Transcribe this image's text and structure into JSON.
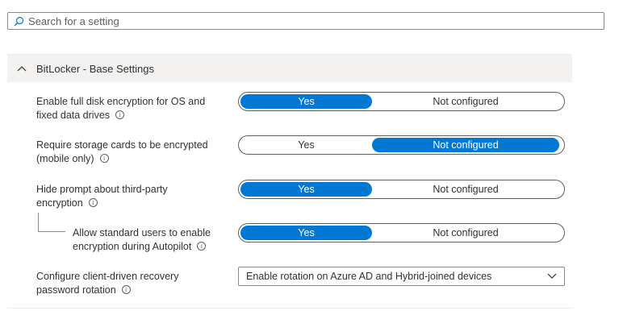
{
  "search": {
    "placeholder": "Search for a setting"
  },
  "section": {
    "title": "BitLocker - Base Settings",
    "expanded": true
  },
  "settings": [
    {
      "label_line1": "Enable full disk encryption for OS and",
      "label_line2": "fixed data drives",
      "options": [
        "Yes",
        "Not configured"
      ],
      "selected": "Yes"
    },
    {
      "label_line1": "Require storage cards to be encrypted",
      "label_line2": "(mobile only)",
      "options": [
        "Yes",
        "Not configured"
      ],
      "selected": "Not configured"
    },
    {
      "label_line1": "Hide prompt about third-party",
      "label_line2": "encryption",
      "options": [
        "Yes",
        "Not configured"
      ],
      "selected": "Yes"
    },
    {
      "label_line1": "Allow standard users to enable",
      "label_line2": "encryption during Autopilot",
      "options": [
        "Yes",
        "Not configured"
      ],
      "selected": "Yes"
    },
    {
      "label_line1": "Configure client-driven recovery",
      "label_line2": "password rotation",
      "dropdown_value": "Enable rotation on Azure AD and Hybrid-joined devices"
    }
  ],
  "colors": {
    "accent": "#0078d4",
    "section_bg": "#f3f2f1",
    "text": "#323130"
  }
}
